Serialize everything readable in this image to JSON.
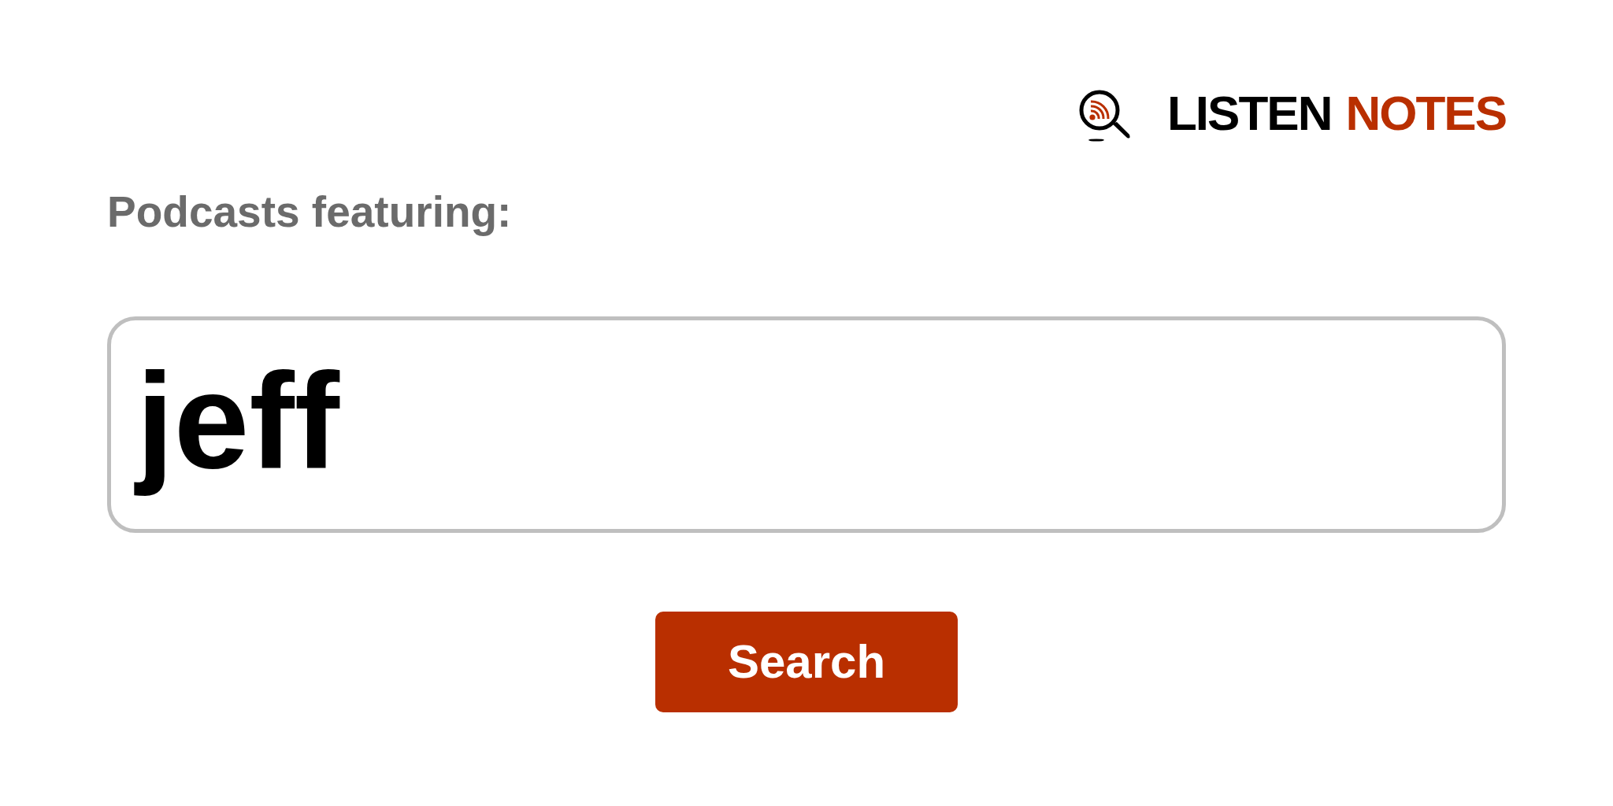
{
  "logo": {
    "words": [
      {
        "text": "LISTEN",
        "color": "#000000"
      },
      {
        "text": "NOTES",
        "color": "#b92f00"
      }
    ]
  },
  "label": "Podcasts featuring:",
  "search": {
    "value": "jeff"
  },
  "button": {
    "label": "Search"
  }
}
